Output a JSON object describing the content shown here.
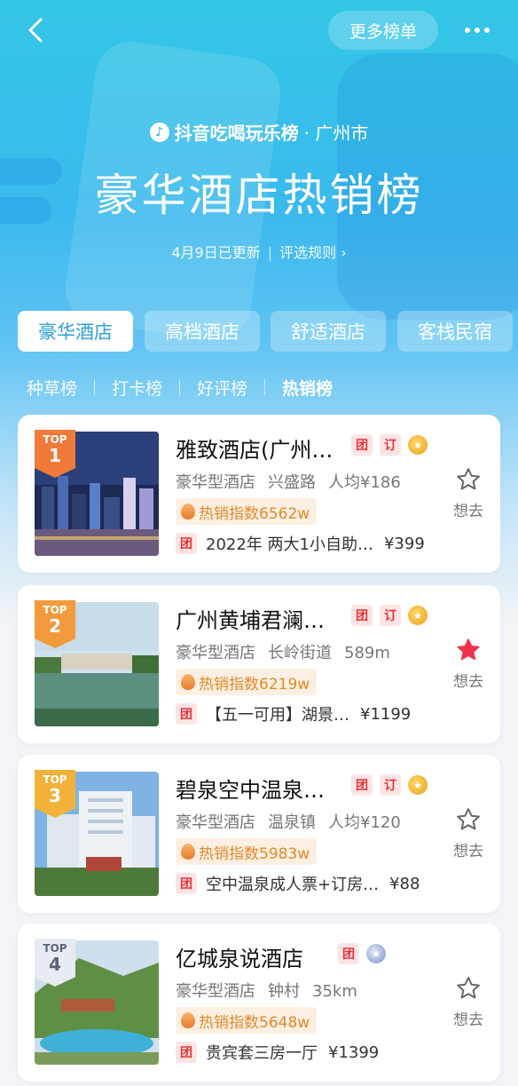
{
  "header": {
    "more_lists_label": "更多榜单",
    "brand": "抖音吃喝玩乐榜",
    "city": "· 广州市",
    "title": "豪华酒店热销榜",
    "update_text": "4月9日已更新",
    "rules_label": "评选规则"
  },
  "tabs": [
    {
      "label": "豪华酒店",
      "active": true
    },
    {
      "label": "高档酒店",
      "active": false
    },
    {
      "label": "舒适酒店",
      "active": false
    },
    {
      "label": "客栈民宿",
      "active": false
    }
  ],
  "subtabs": [
    {
      "label": "种草榜",
      "active": false
    },
    {
      "label": "打卡榜",
      "active": false
    },
    {
      "label": "好评榜",
      "active": false
    },
    {
      "label": "热销榜",
      "active": true
    }
  ],
  "hotels": [
    {
      "rank_top": "TOP",
      "rank": "1",
      "name": "雅致酒店(广州…",
      "tags": [
        "团",
        "订"
      ],
      "medal": "gold",
      "type": "豪华型酒店",
      "area": "兴盛路",
      "extra": "人均¥186",
      "hot_index": "热销指数6562w",
      "deal_tag": "团",
      "deal": "2022年 两大1小自助…",
      "price": "¥399",
      "want_label": "想去",
      "favorited": false,
      "badge_color": "#f07a3a"
    },
    {
      "rank_top": "TOP",
      "rank": "2",
      "name": "广州黄埔君澜…",
      "tags": [
        "团",
        "订"
      ],
      "medal": "gold",
      "type": "豪华型酒店",
      "area": "长岭街道",
      "extra": "589m",
      "hot_index": "热销指数6219w",
      "deal_tag": "团",
      "deal": "【五一可用】湖景…",
      "price": "¥1199",
      "want_label": "想去",
      "favorited": true,
      "badge_color": "#f29a3c"
    },
    {
      "rank_top": "TOP",
      "rank": "3",
      "name": "碧泉空中温泉…",
      "tags": [
        "团",
        "订"
      ],
      "medal": "gold",
      "type": "豪华型酒店",
      "area": "温泉镇",
      "extra": "人均¥120",
      "hot_index": "热销指数5983w",
      "deal_tag": "团",
      "deal": "空中温泉成人票+订房…",
      "price": "¥88",
      "want_label": "想去",
      "favorited": false,
      "badge_color": "#f2b23a"
    },
    {
      "rank_top": "TOP",
      "rank": "4",
      "name": "亿城泉说酒店",
      "tags": [
        "团"
      ],
      "medal": "silver",
      "type": "豪华型酒店",
      "area": "钟村",
      "extra": "35km",
      "hot_index": "热销指数5648w",
      "deal_tag": "团",
      "deal": "贵宾套三房一厅",
      "price": "¥1399",
      "want_label": "想去",
      "favorited": false,
      "badge_color": "#e8ecf2"
    }
  ],
  "colors": {
    "accent": "#2a9fe0",
    "tag_red": "#e8323a",
    "hot_orange": "#e28a2a",
    "star_active": "#f0324a"
  }
}
